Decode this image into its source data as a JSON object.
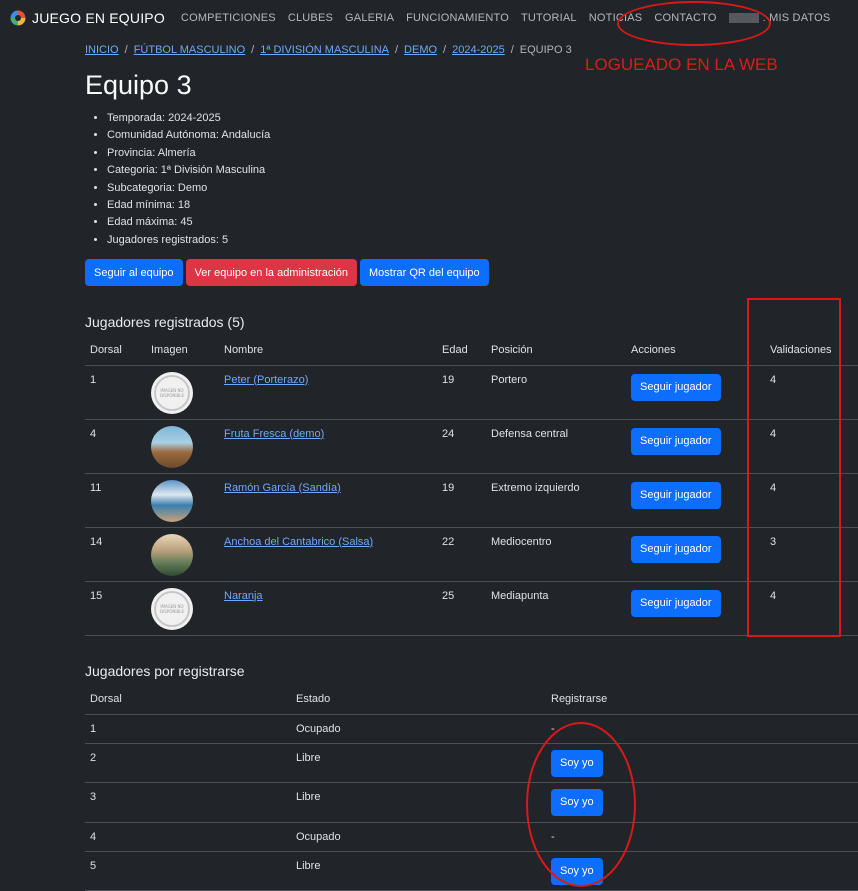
{
  "nav": {
    "brand": "JUEGO EN EQUIPO",
    "items": [
      "COMPETICIONES",
      "CLUBES",
      "GALERIA",
      "FUNCIONAMIENTO",
      "TUTORIAL",
      "NOTICIAS",
      "CONTACTO"
    ],
    "user_suffix": ": MIS DATOS"
  },
  "annotation": {
    "text": "LOGUEADO EN LA WEB",
    "color": "#e01a1a"
  },
  "breadcrumb": {
    "links": [
      "Inicio",
      "Fútbol masculino",
      "1ª División Masculina",
      "Demo",
      "2024-2025"
    ],
    "current": "Equipo 3"
  },
  "team": {
    "title": "Equipo 3",
    "info": [
      "Temporada: 2024-2025",
      "Comunidad Autónoma: Andalucía",
      "Provincia: Almería",
      "Categoria: 1ª División Masculina",
      "Subcategoria: Demo",
      "Edad mínima: 18",
      "Edad máxima: 45",
      "Jugadores registrados: 5"
    ]
  },
  "actions": {
    "follow_team": "Seguir al equipo",
    "view_admin": "Ver equipo en la administración",
    "show_qr": "Mostrar QR del equipo"
  },
  "registered": {
    "title": "Jugadores registrados (5)",
    "headers": [
      "Dorsal",
      "Imagen",
      "Nombre",
      "Edad",
      "Posición",
      "Acciones",
      "Validaciones"
    ],
    "follow_label": "Seguir jugador",
    "no_image_text": "IMAGEN NO DISPONIBLE",
    "rows": [
      {
        "dorsal": "1",
        "name": "Peter (Porterazo)",
        "age": "19",
        "position": "Portero",
        "validations": "4",
        "image": "no-image"
      },
      {
        "dorsal": "4",
        "name": "Fruta Fresca (demo)",
        "age": "24",
        "position": "Defensa central",
        "validations": "4",
        "image": "photo-castle"
      },
      {
        "dorsal": "11",
        "name": "Ramón García (Sandía)",
        "age": "19",
        "position": "Extremo izquierdo",
        "validations": "4",
        "image": "photo-coast"
      },
      {
        "dorsal": "14",
        "name": "Anchoa del Cantabrico (Salsa)",
        "age": "22",
        "position": "Mediocentro",
        "validations": "3",
        "image": "photo-agave"
      },
      {
        "dorsal": "15",
        "name": "Naranja",
        "age": "25",
        "position": "Mediapunta",
        "validations": "4",
        "image": "no-image"
      }
    ]
  },
  "to_register": {
    "title": "Jugadores por registrarse",
    "headers": [
      "Dorsal",
      "Estado",
      "Registrarse"
    ],
    "button_label": "Soy yo",
    "rows": [
      {
        "dorsal": "1",
        "status": "Ocupado",
        "action": "-"
      },
      {
        "dorsal": "2",
        "status": "Libre",
        "action": "button"
      },
      {
        "dorsal": "3",
        "status": "Libre",
        "action": "button"
      },
      {
        "dorsal": "4",
        "status": "Ocupado",
        "action": "-"
      },
      {
        "dorsal": "5",
        "status": "Libre",
        "action": "button"
      }
    ]
  }
}
